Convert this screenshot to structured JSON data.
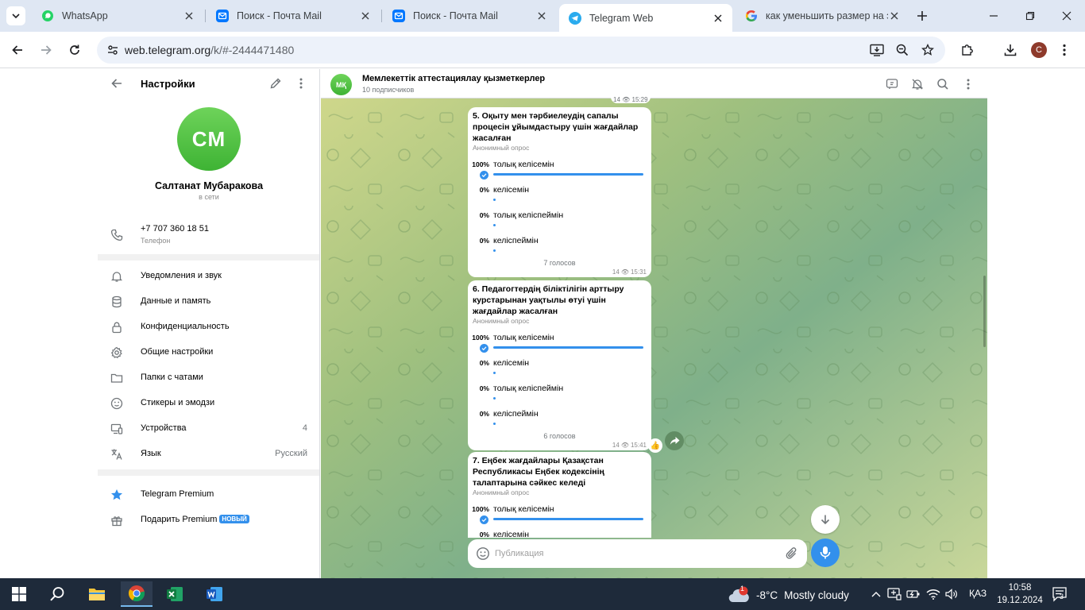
{
  "browser": {
    "tabs": [
      {
        "title": "WhatsApp",
        "icon": "whatsapp-icon",
        "active": false
      },
      {
        "title": "Поиск - Почта Mail",
        "icon": "mail-icon",
        "active": false
      },
      {
        "title": "Поиск - Почта Mail",
        "icon": "mail-icon",
        "active": false
      },
      {
        "title": "Telegram Web",
        "icon": "telegram-icon",
        "active": true
      },
      {
        "title": "как уменьшить размер на экране",
        "icon": "google-icon",
        "active": false
      }
    ],
    "url_host": "web.telegram.org",
    "url_path": "/k/#-2444471480",
    "profile_initial": "C"
  },
  "settings": {
    "title": "Настройки",
    "avatar_initials": "CM",
    "name": "Салтанат Мубаракова",
    "status": "в сети",
    "phone": "+7 707 360 18 51",
    "phone_label": "Телефон",
    "menu": [
      {
        "label": "Уведомления и звук",
        "value": ""
      },
      {
        "label": "Данные и память",
        "value": ""
      },
      {
        "label": "Конфиденциальность",
        "value": ""
      },
      {
        "label": "Общие настройки",
        "value": ""
      },
      {
        "label": "Папки с чатами",
        "value": ""
      },
      {
        "label": "Стикеры и эмодзи",
        "value": ""
      },
      {
        "label": "Устройства",
        "value": "4"
      },
      {
        "label": "Язык",
        "value": "Русский"
      }
    ],
    "premium": "Telegram Premium",
    "gift_premium": "Подарить Premium",
    "new_badge": "НОВЫЙ"
  },
  "chat": {
    "avatar_initials": "МҚ",
    "title": "Мемлекеттік аттестациялау қызметкерлер",
    "subtitle": "10 подписчиков",
    "prev_meta": {
      "views": "14",
      "time": "15:29"
    },
    "composer_placeholder": "Публикация",
    "polls": [
      {
        "question": "5. Оқыту мен тәрбиелеудің сапалы процесін ұйымдастыру үшін жағдайлар жасалған",
        "type": "Анонимный опрос",
        "options": [
          {
            "pct": "100%",
            "text": "толық келісемін",
            "value": 1.0,
            "checked": true
          },
          {
            "pct": "0%",
            "text": "келісемін",
            "value": 0,
            "checked": false
          },
          {
            "pct": "0%",
            "text": "толық келіспеймін",
            "value": 0,
            "checked": false
          },
          {
            "pct": "0%",
            "text": "келіспеймін",
            "value": 0,
            "checked": false
          }
        ],
        "votes": "7 голосов",
        "views": "14",
        "time": "15:31"
      },
      {
        "question": "6. Педагогтердің біліктілігін арттыру курстарынан уақтылы өтуі үшін жағдайлар жасалған",
        "type": "Анонимный опрос",
        "options": [
          {
            "pct": "100%",
            "text": "толық келісемін",
            "value": 1.0,
            "checked": true
          },
          {
            "pct": "0%",
            "text": "келісемін",
            "value": 0,
            "checked": false
          },
          {
            "pct": "0%",
            "text": "толық келіспеймін",
            "value": 0,
            "checked": false
          },
          {
            "pct": "0%",
            "text": "келіспеймін",
            "value": 0,
            "checked": false
          }
        ],
        "votes": "6 голосов",
        "views": "14",
        "time": "15:41"
      },
      {
        "question": "7. Еңбек жағдайлары Қазақстан Республикасы Еңбек кодексінің талаптарына сәйкес келеді",
        "type": "Анонимный опрос",
        "options": [
          {
            "pct": "100%",
            "text": "толық келісемін",
            "value": 1.0,
            "checked": true
          },
          {
            "pct": "0%",
            "text": "келісемін",
            "value": 0,
            "checked": false
          }
        ],
        "votes": "",
        "views": "",
        "time": ""
      }
    ],
    "reaction": "👍"
  },
  "taskbar": {
    "weather_temp": "-8°C",
    "weather_condition": "Mostly cloudy",
    "weather_badge": "1",
    "language": "ҚАЗ",
    "time": "10:58",
    "date": "19.12.2024",
    "notifications": "3"
  },
  "colors": {
    "accent": "#3390ec",
    "avatar_green": "#4fc043",
    "tab_strip": "#dfe7f3",
    "taskbar": "#1e2a3a"
  }
}
